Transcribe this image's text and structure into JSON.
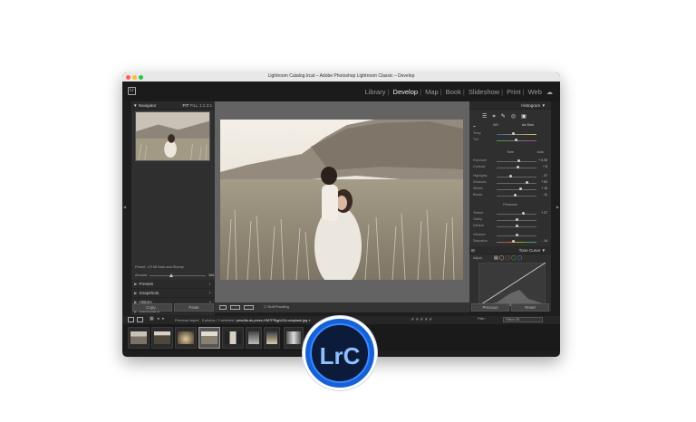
{
  "window": {
    "title": "Lightroom Catalog.lrcat – Adobe Photoshop Lightroom Classic – Develop",
    "brand_badge": "Lr"
  },
  "modules": {
    "items": [
      "Library",
      "Develop",
      "Map",
      "Book",
      "Slideshow",
      "Print",
      "Web"
    ],
    "active": "Develop"
  },
  "left_panel": {
    "navigator": {
      "label": "Navigator",
      "zoom_options": [
        "FIT",
        "FILL",
        "1:1",
        "2:1"
      ]
    },
    "preset_line": "Preset : LR Mt Dark and Stormy",
    "amount": {
      "label": "Amount",
      "value": "100"
    },
    "sections": [
      {
        "label": "Presets",
        "icon": "plus"
      },
      {
        "label": "Snapshots",
        "icon": "plus"
      },
      {
        "label": "History",
        "icon": "x"
      },
      {
        "label": "Collections",
        "icon": "plus"
      }
    ],
    "copy_label": "Copy...",
    "paste_label": "Paste"
  },
  "toolbar": {
    "soft_proofing_label": "Soft Proofing"
  },
  "right_panel": {
    "histogram_label": "Histogram",
    "wb_label": "WB :",
    "wb_value": "As Shot",
    "groups": [
      {
        "label": "Tone",
        "auto_label": "Auto"
      },
      {
        "label": "Presence"
      }
    ],
    "sliders_top": [
      {
        "label": "Temp",
        "value": ""
      },
      {
        "label": "Tint",
        "value": ""
      }
    ],
    "sliders_tone": [
      {
        "label": "Exposure",
        "value": "+ 0.30"
      },
      {
        "label": "Contrast",
        "value": "+ 8"
      },
      {
        "label": "Highlights",
        "value": "- 37"
      },
      {
        "label": "Shadows",
        "value": "+ 52"
      },
      {
        "label": "Whites",
        "value": "+ 15"
      },
      {
        "label": "Blacks",
        "value": "- 11"
      }
    ],
    "sliders_presence": [
      {
        "label": "Texture",
        "value": "+ 27"
      },
      {
        "label": "Clarity",
        "value": ""
      },
      {
        "label": "Dehaze",
        "value": ""
      },
      {
        "label": "Vibrance",
        "value": ""
      },
      {
        "label": "Saturation",
        "value": "- 14"
      }
    ],
    "tone_curve_label": "Tone Curve",
    "adjust_label": "Adjust",
    "previous_label": "Previous",
    "reset_label": "Reset"
  },
  "filmstrip": {
    "source": "Previous Import",
    "count_text": "5 photos / 1 selected /",
    "filename": "priscilla-du-preez-HM7PRgyU2Ai-unsplash.jpg",
    "filter_label": "Filter :",
    "filter_value": "Filters Off"
  },
  "logo": {
    "text": "LrC"
  },
  "colors": {
    "accent": "#1561d8",
    "logo_text": "#8ec0ff"
  }
}
